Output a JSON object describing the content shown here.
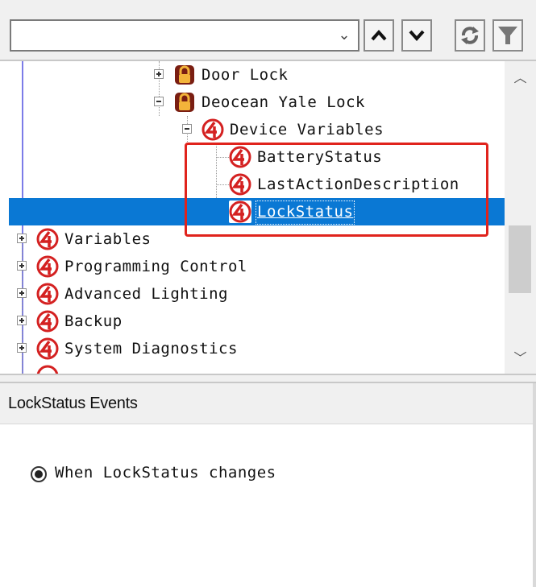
{
  "toolbar": {
    "search_value": "",
    "combo_arrow_icon": "chevron-down-icon",
    "buttons": [
      {
        "name": "move-up-button",
        "icon": "caret-up-icon"
      },
      {
        "name": "move-down-button",
        "icon": "caret-down-icon"
      },
      {
        "name": "refresh-button",
        "icon": "refresh-icon"
      },
      {
        "name": "filter-button",
        "icon": "filter-icon"
      }
    ]
  },
  "tree": {
    "items": [
      {
        "label": "Door Lock",
        "icon": "lock-icon",
        "expander": "plus"
      },
      {
        "label": "Deocean Yale Lock",
        "icon": "lock-icon",
        "expander": "minus"
      },
      {
        "label": "Device Variables",
        "icon": "control4-icon",
        "expander": "minus"
      },
      {
        "label": "BatteryStatus",
        "icon": "control4-icon"
      },
      {
        "label": "LastActionDescription",
        "icon": "control4-icon"
      },
      {
        "label": "LockStatus",
        "icon": "control4-icon",
        "selected": true
      },
      {
        "label": "Variables",
        "icon": "control4-icon",
        "expander": "plus"
      },
      {
        "label": "Programming Control",
        "icon": "control4-icon",
        "expander": "plus"
      },
      {
        "label": "Advanced Lighting",
        "icon": "control4-icon",
        "expander": "plus"
      },
      {
        "label": "Backup",
        "icon": "control4-icon",
        "expander": "plus"
      },
      {
        "label": "System Diagnostics",
        "icon": "control4-icon",
        "expander": "plus"
      }
    ],
    "highlight_color": "#e0231c",
    "selection_color": "#0a78d4"
  },
  "scrollbar": {
    "up_icon": "chevron-up-icon",
    "down_icon": "chevron-down-icon"
  },
  "events": {
    "title": "LockStatus Events",
    "options": [
      {
        "label": "When LockStatus changes",
        "checked": true
      }
    ]
  }
}
